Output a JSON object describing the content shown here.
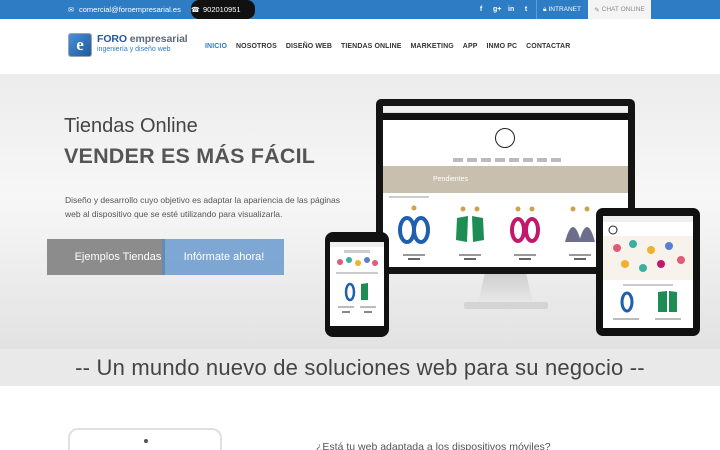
{
  "topbar": {
    "email": "comercial@foroempresarial.es",
    "phone": "902010951",
    "social_icons": [
      "facebook-icon",
      "google-plus-icon",
      "linkedin-icon",
      "twitter-icon"
    ],
    "intranet_label": "INTRANET",
    "chat_label": "CHAT ONLINE",
    "bar_color": "#2d7cc4"
  },
  "header": {
    "logo_mark": "e",
    "logo_foro": "FORO",
    "logo_empresarial": "empresarial",
    "logo_tagline": "ingeniería y diseño web",
    "nav": [
      {
        "label": "INICIO",
        "active": true
      },
      {
        "label": "NOSOTROS",
        "active": false
      },
      {
        "label": "DISEÑO WEB",
        "active": false
      },
      {
        "label": "TIENDAS ONLINE",
        "active": false
      },
      {
        "label": "MARKETING",
        "active": false
      },
      {
        "label": "APP",
        "active": false
      },
      {
        "label": "INMO PC",
        "active": false
      },
      {
        "label": "CONTACTAR",
        "active": false
      }
    ]
  },
  "hero": {
    "title": "Tiendas Online",
    "subtitle": "VENDER ES MÁS FÁCIL",
    "description": "Diseño y desarrollo cuyo objetivo es adaptar la apariencia de las páginas web al dispositivo que se esté utilizando para visualizarla.",
    "button_examples": "Ejemplos Tiendas",
    "button_info": "Infórmate ahora!",
    "screen_banner": "Pendientes"
  },
  "tagline": "-- Un mundo nuevo de soluciones web para su negocio --",
  "bottom": {
    "question": "¿Está tu web adaptada a los dispositivos móviles?"
  }
}
